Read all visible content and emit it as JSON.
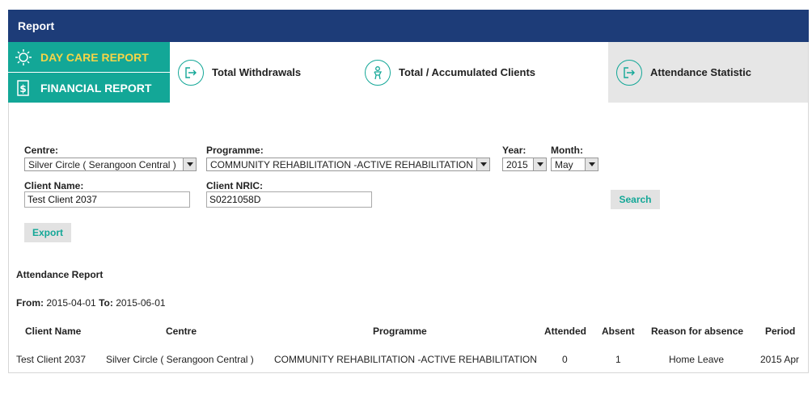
{
  "header": {
    "title": "Report"
  },
  "side_nav": {
    "items": [
      {
        "label": "DAY CARE REPORT",
        "icon": "sun-icon"
      },
      {
        "label": "FINANCIAL REPORT",
        "icon": "dollar-document-icon"
      }
    ]
  },
  "tabs": [
    {
      "label": "Total Withdrawals",
      "icon": "exit-arrow-icon"
    },
    {
      "label": "Total / Accumulated Clients",
      "icon": "person-icon"
    },
    {
      "label": "Attendance Statistic",
      "icon": "exit-arrow-icon",
      "active": true
    }
  ],
  "filters": {
    "centre_label": "Centre:",
    "centre_value": "Silver Circle ( Serangoon Central )",
    "programme_label": "Programme:",
    "programme_value": "COMMUNITY REHABILITATION -ACTIVE REHABILITATION",
    "year_label": "Year:",
    "year_value": "2015",
    "month_label": "Month:",
    "month_value": "May",
    "client_name_label": "Client Name:",
    "client_name_value": "Test Client 2037",
    "client_nric_label": "Client NRIC:",
    "client_nric_value": "S0221058D",
    "search_label": "Search",
    "export_label": "Export"
  },
  "report": {
    "title": "Attendance Report",
    "from_label": "From:",
    "from_value": "2015-04-01",
    "to_label": "To:",
    "to_value": "2015-06-01",
    "columns": [
      "Client Name",
      "Centre",
      "Programme",
      "Attended",
      "Absent",
      "Reason for absence",
      "Period"
    ],
    "rows": [
      [
        "Test Client 2037",
        "Silver Circle ( Serangoon Central )",
        "COMMUNITY REHABILITATION -ACTIVE REHABILITATION",
        "0",
        "1",
        "Home Leave",
        "2015 Apr"
      ]
    ]
  },
  "colors": {
    "header": "#1d3c78",
    "teal": "#13a797",
    "yellow": "#f5d547",
    "active_tab": "#e6e6e6"
  }
}
